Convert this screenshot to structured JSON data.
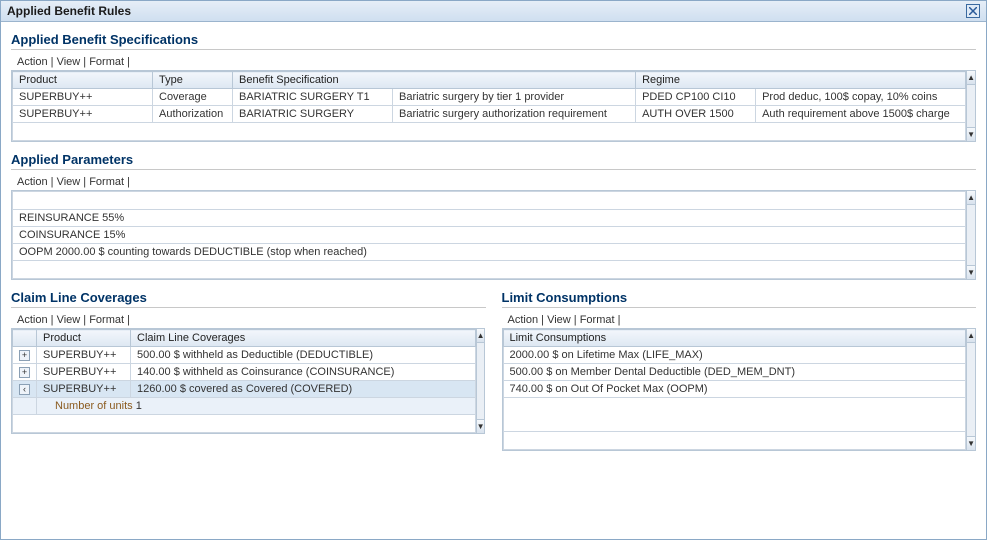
{
  "window": {
    "title": "Applied Benefit Rules"
  },
  "sections": {
    "spec": {
      "title": "Applied Benefit Specifications"
    },
    "params": {
      "title": "Applied Parameters"
    },
    "coverages": {
      "title": "Claim Line Coverages"
    },
    "limits": {
      "title": "Limit Consumptions"
    }
  },
  "toolbar": {
    "action": "Action",
    "view": "View",
    "format": "Format"
  },
  "spec_headers": {
    "product": "Product",
    "type": "Type",
    "benefit_spec": "Benefit Specification",
    "regime": "Regime"
  },
  "spec_rows": [
    {
      "product": "SUPERBUY++",
      "type": "Coverage",
      "spec_code": "BARIATRIC SURGERY T1",
      "spec_desc": "Bariatric surgery by tier 1 provider",
      "regime_code": "PDED CP100 CI10",
      "regime_desc": "Prod deduc, 100$ copay, 10% coins"
    },
    {
      "product": "SUPERBUY++",
      "type": "Authorization",
      "spec_code": "BARIATRIC SURGERY",
      "spec_desc": "Bariatric surgery authorization requirement",
      "regime_code": "AUTH OVER 1500",
      "regime_desc": "Auth requirement above 1500$ charge"
    }
  ],
  "param_rows": [
    "REINSURANCE 55%",
    "COINSURANCE 15%",
    "OOPM 2000.00 $ counting towards DEDUCTIBLE (stop when reached)"
  ],
  "cov_headers": {
    "product": "Product",
    "cov": "Claim Line Coverages"
  },
  "cov_rows": [
    {
      "exp": "plus",
      "product": "SUPERBUY++",
      "text": "500.00  $  withheld as Deductible (DEDUCTIBLE)"
    },
    {
      "exp": "plus",
      "product": "SUPERBUY++",
      "text": "140.00  $  withheld as Coinsurance (COINSURANCE)"
    },
    {
      "exp": "minus",
      "product": "SUPERBUY++",
      "text": "1260.00  $  covered as Covered (COVERED)",
      "selected": true
    }
  ],
  "cov_detail": {
    "label": "Number of units",
    "value": "1"
  },
  "limit_header": "Limit Consumptions",
  "limit_rows": [
    "2000.00  $  on Lifetime Max (LIFE_MAX)",
    "500.00  $  on Member Dental Deductible (DED_MEM_DNT)",
    "740.00  $  on Out Of Pocket Max (OOPM)"
  ]
}
